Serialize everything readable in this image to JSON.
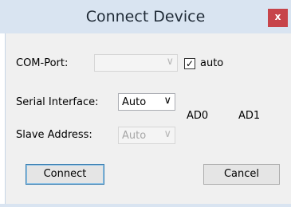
{
  "window": {
    "title": "Connect Device",
    "close_label": "x"
  },
  "form": {
    "com_port": {
      "label": "COM-Port:",
      "value": "",
      "enabled": false
    },
    "auto": {
      "label": "auto",
      "checked": true
    },
    "serial_interface": {
      "label": "Serial Interface:",
      "value": "Auto",
      "enabled": true
    },
    "slave_address": {
      "label": "Slave Address:",
      "value": "Auto",
      "enabled": false
    },
    "ad0": "AD0",
    "ad1": "AD1"
  },
  "buttons": {
    "connect": "Connect",
    "cancel": "Cancel"
  },
  "icons": {
    "dropdown": "chevron-down-icon",
    "check": "checkmark-icon"
  },
  "colors": {
    "titlebar": "#d9e4f1",
    "close": "#c7444a",
    "client": "#f0f0f0",
    "accent": "#3c7fb1"
  }
}
